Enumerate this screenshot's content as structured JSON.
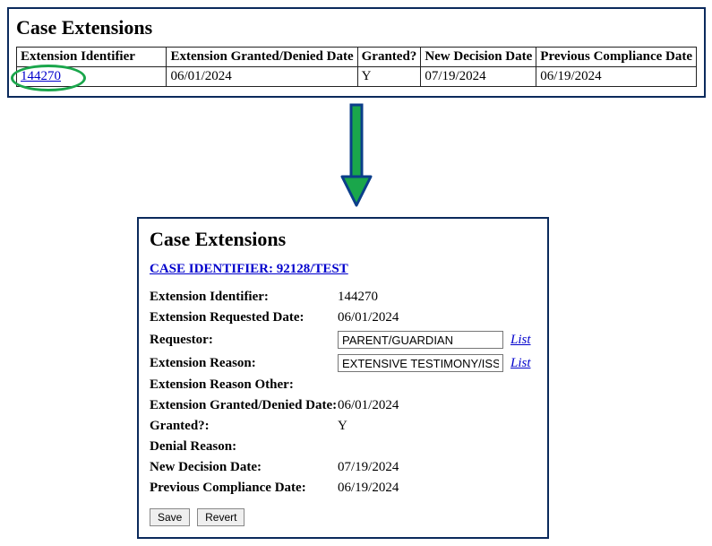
{
  "top": {
    "title": "Case Extensions",
    "headers": [
      "Extension Identifier",
      "Extension Granted/Denied Date",
      "Granted?",
      "New Decision Date",
      "Previous Compliance Date"
    ],
    "row": {
      "id": "144270",
      "granted_denied_date": "06/01/2024",
      "granted": "Y",
      "new_decision_date": "07/19/2024",
      "previous_compliance_date": "06/19/2024"
    }
  },
  "detail": {
    "title": "Case Extensions",
    "case_link": "CASE IDENTIFIER: 92128/TEST",
    "fields": {
      "extension_identifier_label": "Extension Identifier:",
      "extension_identifier_value": "144270",
      "requested_date_label": "Extension Requested Date:",
      "requested_date_value": "06/01/2024",
      "requestor_label": "Requestor:",
      "requestor_value": "PARENT/GUARDIAN",
      "reason_label": "Extension Reason:",
      "reason_value": "EXTENSIVE TESTIMONY/ISSUES",
      "reason_other_label": "Extension Reason Other:",
      "reason_other_value": "",
      "granted_denied_date_label": "Extension Granted/Denied Date:",
      "granted_denied_date_value": "06/01/2024",
      "granted_label": "Granted?:",
      "granted_value": "Y",
      "denial_reason_label": "Denial Reason:",
      "denial_reason_value": "",
      "new_decision_date_label": "New Decision Date:",
      "new_decision_date_value": "07/19/2024",
      "previous_compliance_date_label": "Previous Compliance Date:",
      "previous_compliance_date_value": "06/19/2024"
    },
    "list_link": "List",
    "buttons": {
      "save": "Save",
      "revert": "Revert"
    }
  }
}
